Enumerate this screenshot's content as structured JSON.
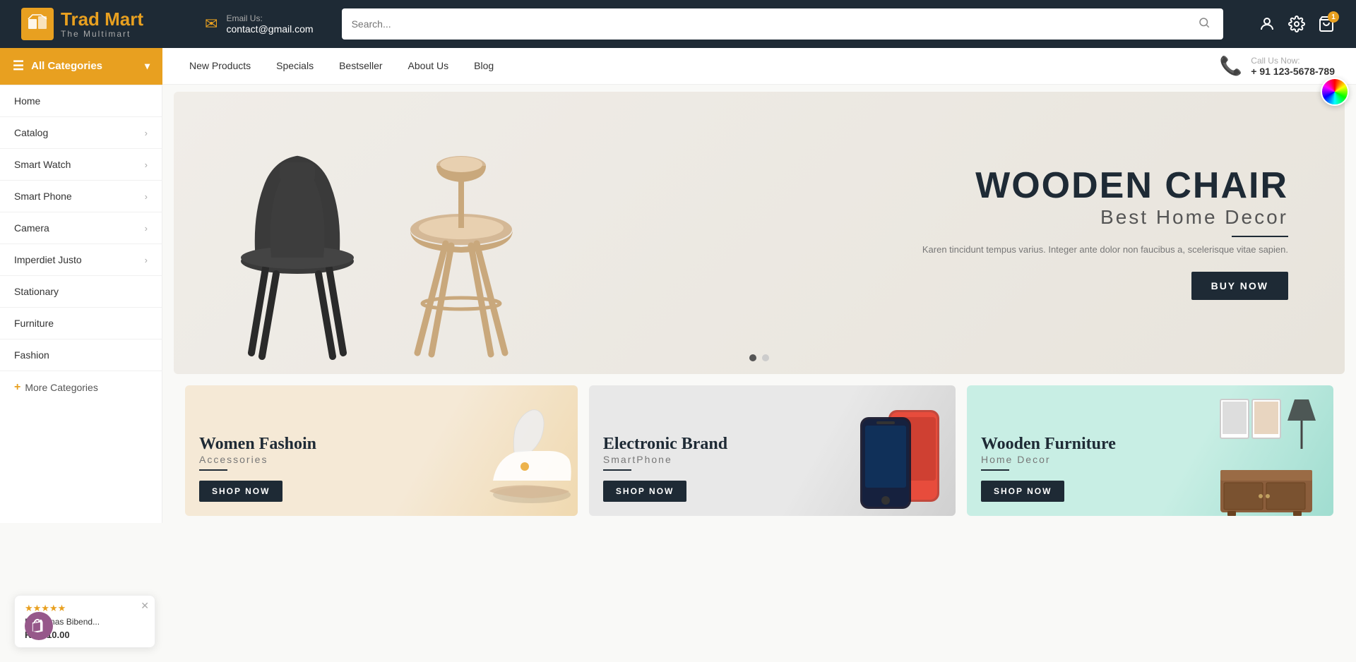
{
  "header": {
    "logo": {
      "brand_part1": "Trad",
      "brand_part2": " Mart",
      "tagline": "The Multimart"
    },
    "email": {
      "label": "Email Us:",
      "value": "contact@gmail.com"
    },
    "search": {
      "placeholder": "Search..."
    },
    "cart_count": "1"
  },
  "navbar": {
    "categories_label": "All Categories",
    "links": [
      {
        "label": "New Products",
        "id": "new-products"
      },
      {
        "label": "Specials",
        "id": "specials"
      },
      {
        "label": "Bestseller",
        "id": "bestseller"
      },
      {
        "label": "About Us",
        "id": "about-us"
      },
      {
        "label": "Blog",
        "id": "blog"
      }
    ],
    "call": {
      "label": "Call Us Now:",
      "number": "+ 91 123-5678-789"
    }
  },
  "sidebar": {
    "items": [
      {
        "label": "Home",
        "has_arrow": false
      },
      {
        "label": "Catalog",
        "has_arrow": true
      },
      {
        "label": "Smart Watch",
        "has_arrow": true
      },
      {
        "label": "Smart Phone",
        "has_arrow": true
      },
      {
        "label": "Camera",
        "has_arrow": true
      },
      {
        "label": "Imperdiet Justo",
        "has_arrow": true
      },
      {
        "label": "Stationary",
        "has_arrow": false
      },
      {
        "label": "Furniture",
        "has_arrow": false
      },
      {
        "label": "Fashion",
        "has_arrow": false
      }
    ],
    "more_label": "More Categories"
  },
  "hero": {
    "title": "WOODEN CHAIR",
    "subtitle": "Best Home Decor",
    "description": "Karen tincidunt tempus varius. Integer ante dolor non faucibus a, scelerisque vitae sapien.",
    "btn_label": "BUY NOW"
  },
  "promo": {
    "cards": [
      {
        "title": "Women Fashoin",
        "subtitle": "Accessories",
        "btn_label": "SHOP NOW",
        "type": "women"
      },
      {
        "title": "Electronic Brand",
        "subtitle": "SmartPhone",
        "btn_label": "SHOP NOW",
        "type": "electronics"
      },
      {
        "title": "Wooden Furniture",
        "subtitle": "Home Decor",
        "btn_label": "SHOP NOW",
        "type": "furniture"
      }
    ]
  },
  "widget": {
    "stars": "★★★★★",
    "name": "Maecenas Bibend...",
    "price": "Rs. 710.00"
  }
}
